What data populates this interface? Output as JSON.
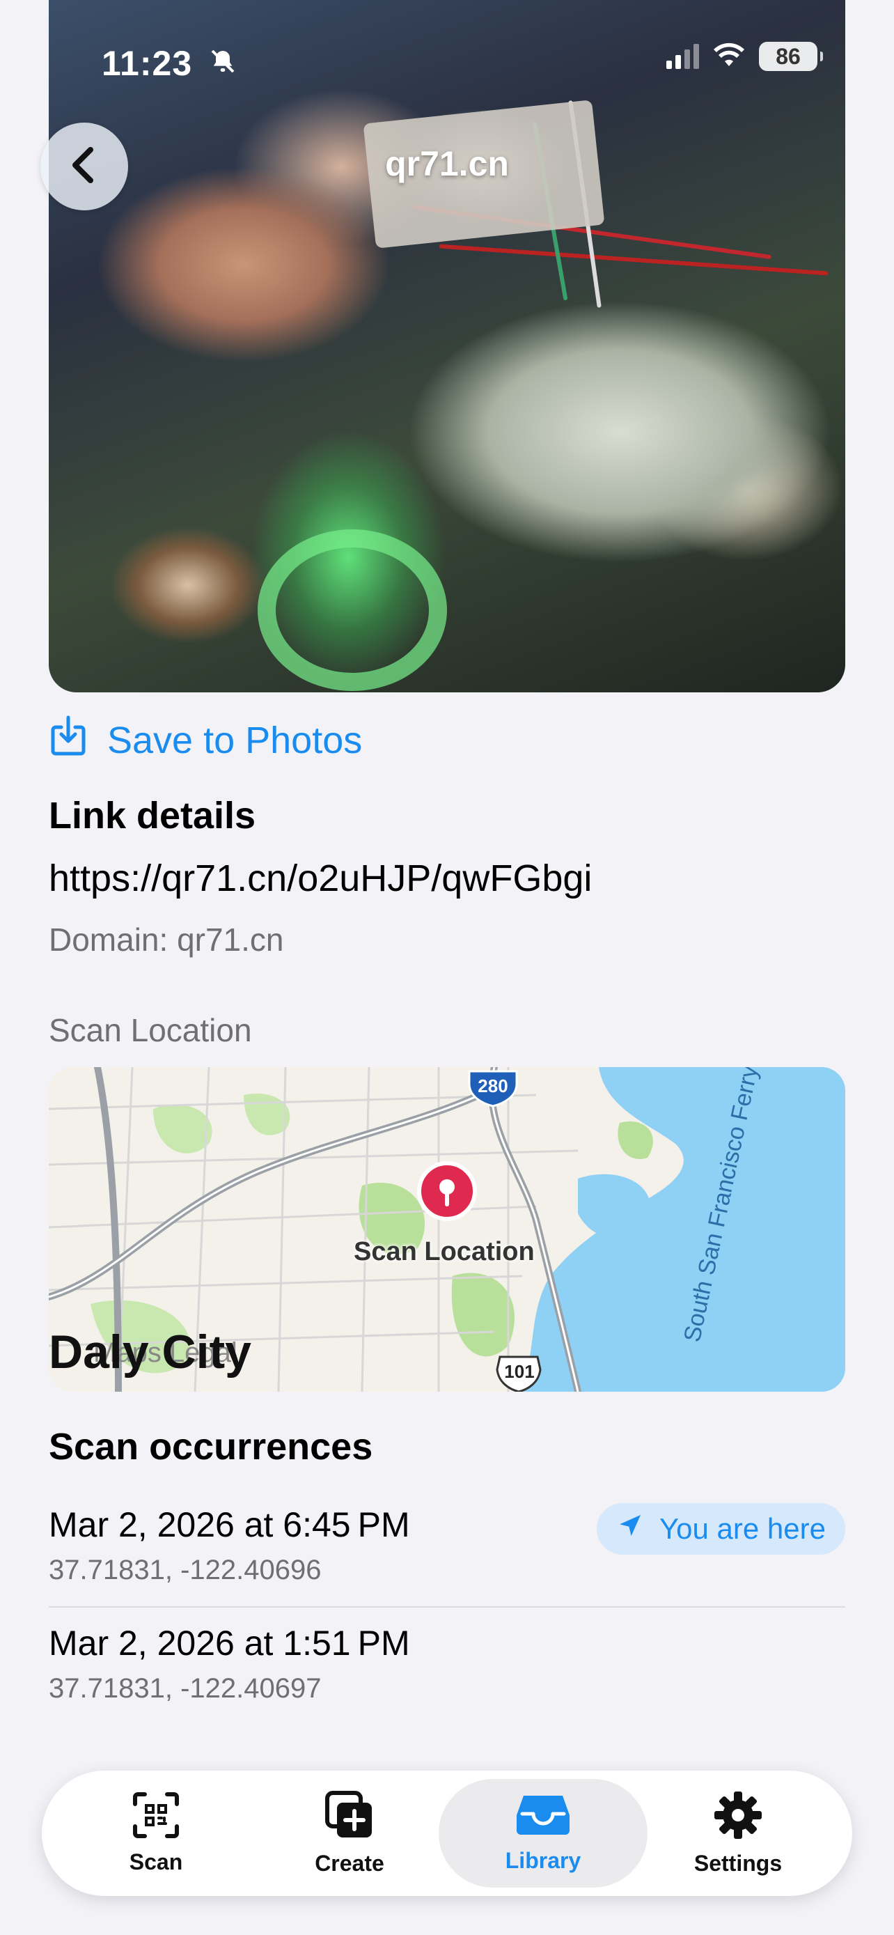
{
  "status": {
    "time": "11:23",
    "battery": "86"
  },
  "nav": {
    "title": "qr71.cn"
  },
  "actions": {
    "save_label": "Save to Photos"
  },
  "link": {
    "heading": "Link details",
    "url": "https://qr71.cn/o2uHJP/qwFGbgi",
    "domain": "Domain: qr71.cn"
  },
  "location": {
    "heading": "Scan Location",
    "map": {
      "pin_label": "Scan Location",
      "city": "Daly City",
      "city_overlay": "Maps Legal",
      "ferry": "South San Francisco Ferry",
      "shield_280": "280",
      "shield_101": "101"
    }
  },
  "occurrences": {
    "heading": "Scan occurrences",
    "items": [
      {
        "date": "Mar 2, 2026 at 6:45 PM",
        "coords": "37.71831, -122.40696",
        "badge": "You are here"
      },
      {
        "date": "Mar 2, 2026 at 1:51 PM",
        "coords": "37.71831, -122.40697"
      }
    ]
  },
  "tabs": [
    {
      "label": "Scan",
      "icon": "qr-scan-icon"
    },
    {
      "label": "Create",
      "icon": "create-plus-icon"
    },
    {
      "label": "Library",
      "icon": "tray-icon",
      "active": true
    },
    {
      "label": "Settings",
      "icon": "gear-icon"
    }
  ],
  "colors": {
    "accent": "#1a8cf0",
    "pin": "#e0294f",
    "water": "#8fd0f5"
  }
}
